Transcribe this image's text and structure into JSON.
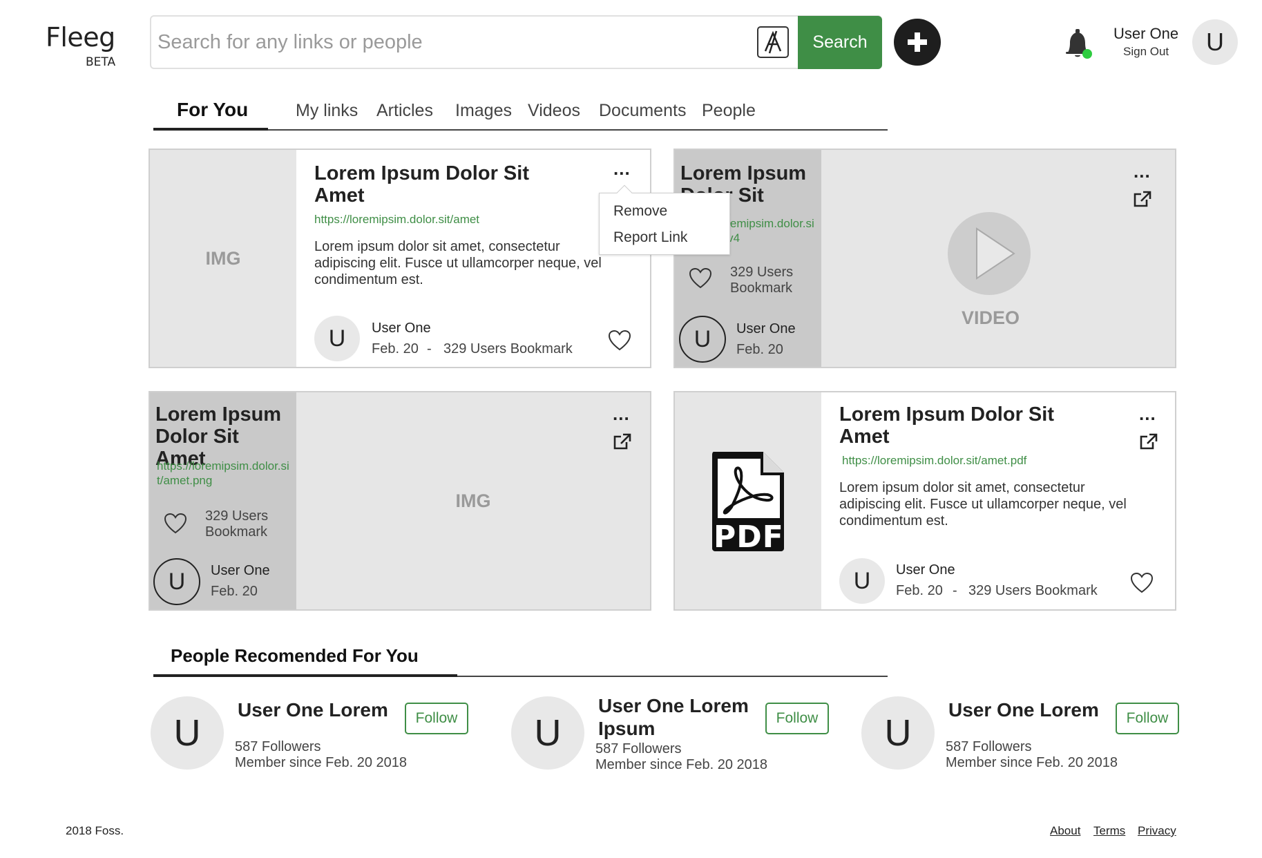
{
  "header": {
    "logo": "Fleeg",
    "beta": "BETA",
    "search_placeholder": "Search for any links or people",
    "search_button": "Search",
    "user_name": "User One",
    "sign_out": "Sign Out",
    "avatar_initial": "U"
  },
  "tabs": [
    {
      "label": "For You"
    },
    {
      "label": "My links"
    },
    {
      "label": "Articles"
    },
    {
      "label": "Images"
    },
    {
      "label": "Videos"
    },
    {
      "label": "Documents"
    },
    {
      "label": "People"
    }
  ],
  "cards": [
    {
      "image_label": "IMG",
      "title": "Lorem Ipsum Dolor Sit Amet",
      "url": "https://loremipsim.dolor.sit/amet",
      "description": "Lorem ipsum dolor sit amet, consectetur adipiscing elit. Fusce ut ullamcorper neque, vel condimentum est.",
      "author_initial": "U",
      "author": "User One",
      "date": "Feb. 20",
      "separator": "-",
      "bookmarks": "329 Users Bookmark",
      "menu": "..."
    },
    {
      "title": "Lorem Ipsum Dolor Sit Amet",
      "url": "https://loremipsim.dolor.sit/amet.mv4",
      "bookmarks": "329 Users Bookmark",
      "author_initial": "U",
      "author": "User One",
      "date": "Feb. 20",
      "media_label": "VIDEO",
      "menu": "..."
    },
    {
      "title": "Lorem Ipsum Dolor Sit Amet",
      "url": "https://loremipsim.dolor.sit/amet.png",
      "bookmarks": "329 Users Bookmark",
      "author_initial": "U",
      "author": "User One",
      "date": "Feb. 20",
      "media_label": "IMG",
      "menu": "..."
    },
    {
      "file_label": "PDF",
      "title": "Lorem Ipsum Dolor Sit Amet",
      "url": "https://loremipsim.dolor.sit/amet.pdf",
      "description": "Lorem ipsum dolor sit amet, consectetur adipiscing elit. Fusce ut ullamcorper neque, vel condimentum est.",
      "author_initial": "U",
      "author": "User One",
      "date": "Feb. 20",
      "separator": "-",
      "bookmarks": "329 Users Bookmark",
      "menu": "..."
    }
  ],
  "dropdown": {
    "items": [
      {
        "label": "Remove"
      },
      {
        "label": "Report Link"
      }
    ]
  },
  "people_section": {
    "title": "People Recomended For You",
    "people": [
      {
        "initial": "U",
        "name": "User One Lorem",
        "followers": "587 Followers",
        "member_since": "Member since Feb. 20  2018",
        "follow": "Follow"
      },
      {
        "initial": "U",
        "name": "User One Lorem Ipsum",
        "followers": "587 Followers",
        "member_since": "Member since Feb. 20  2018",
        "follow": "Follow"
      },
      {
        "initial": "U",
        "name": "User One Lorem",
        "followers": "587 Followers",
        "member_since": "Member since Feb. 20  2018",
        "follow": "Follow"
      }
    ]
  },
  "footer": {
    "copyright": "2018 Foss.",
    "links": [
      {
        "label": "About"
      },
      {
        "label": "Terms"
      },
      {
        "label": "Privacy"
      }
    ]
  },
  "colors": {
    "accent_green": "#3f8e46",
    "notification_dot": "#2ecc40",
    "placeholder_gray": "#e6e6e6",
    "panel_gray": "#c9c9c9"
  },
  "icons": [
    "translate-icon",
    "plus-icon",
    "bell-icon",
    "heart-icon",
    "external-link-icon",
    "play-icon",
    "pdf-file-icon"
  ]
}
